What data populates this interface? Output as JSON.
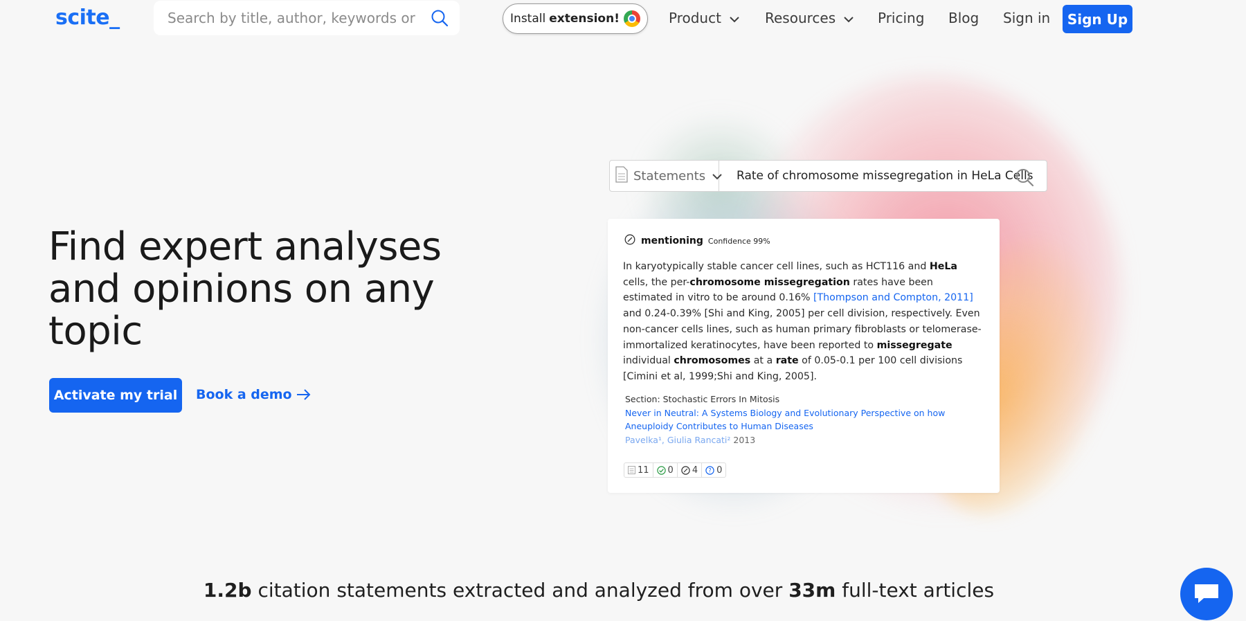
{
  "nav": {
    "logo": "scite_",
    "search_placeholder": "Search by title, author, keywords or DOI",
    "install_text": "Install",
    "install_bold": "extension!",
    "links": {
      "product": "Product",
      "resources": "Resources",
      "pricing": "Pricing",
      "blog": "Blog",
      "signin": "Sign in"
    },
    "signup": "Sign Up"
  },
  "hero": {
    "title": "Find expert analyses and opinions on any topic",
    "cta_primary": "Activate my trial",
    "cta_secondary": "Book a demo"
  },
  "demo": {
    "search_type": "Statements",
    "query": "Rate of chromosome missegregation in HeLa Cells",
    "card": {
      "label": "mentioning",
      "confidence": "Confidence 99%",
      "text": {
        "t1": "In karyotypically stable cancer cell lines, such as HCT116 and ",
        "b1": "HeLa",
        "t2": " cells, the per-",
        "b2": "chromosome missegregation",
        "t3": " rates have been estimated in vitro to be around 0.16% ",
        "cite": "[Thompson and Compton, 2011]",
        "t4": " and 0.24-0.39% [Shi and King, 2005] per cell division, respectively. Even non-cancer cells lines, such as human primary fibroblasts or telomerase-immortalized keratinocytes, have been reported to ",
        "b3": "missegregate",
        "t5": " individual ",
        "b4": "chromosomes",
        "t6": " at a ",
        "b5": "rate",
        "t7": " of 0.05-0.1 per 100 cell divisions [Cimini et al, 1999;Shi and King, 2005]."
      },
      "section": "Section: Stochastic Errors In Mitosis",
      "paper_title": "Never in Neutral: A Systems Biology and Evolutionary Perspective on how Aneuploidy Contributes to Human Diseases",
      "authors": "Pavelka¹, Giulia Rancati²",
      "year": "2013",
      "tally": {
        "publications": "11",
        "supporting": "0",
        "mentioning": "4",
        "contrasting": "0"
      }
    }
  },
  "stats": {
    "n1": "1.2b",
    "t1": " citation statements extracted and analyzed from over ",
    "n2": "33m",
    "t2": " full-text articles"
  },
  "colors": {
    "brand": "#1565f0",
    "background": "#f7f7f7"
  }
}
